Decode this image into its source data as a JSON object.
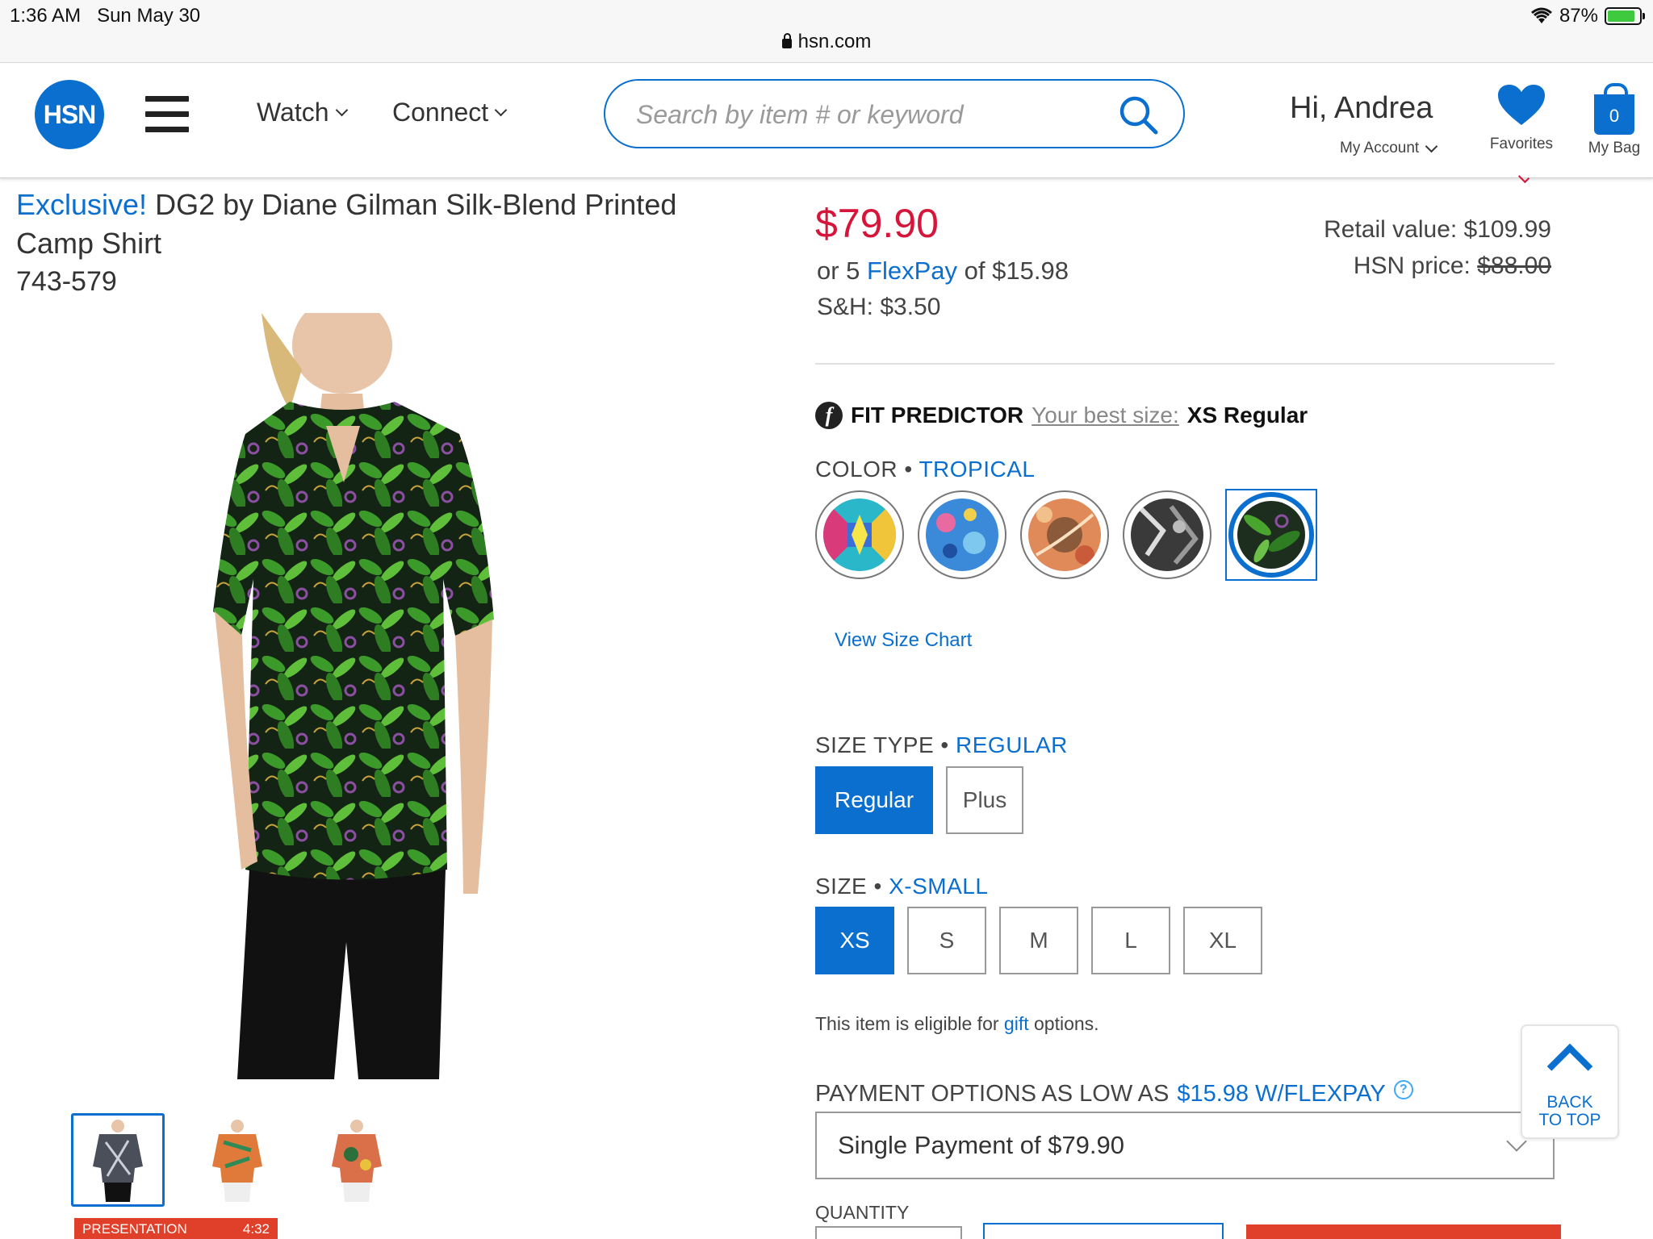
{
  "status_bar": {
    "time": "1:36 AM",
    "date": "Sun May 30",
    "battery": "87%",
    "url": "hsn.com"
  },
  "header": {
    "logo": "HSN",
    "nav": [
      {
        "label": "Watch"
      },
      {
        "label": "Connect"
      }
    ],
    "search_placeholder": "Search by item # or keyword",
    "greeting": "Hi, Andrea",
    "my_account": "My Account",
    "favorites": "Favorites",
    "bag_label": "My Bag",
    "bag_count": "0"
  },
  "product": {
    "exclusive": "Exclusive!",
    "title": "DG2 by Diane Gilman Silk-Blend Printed Camp Shirt",
    "sku": "743-579",
    "price": "$79.90",
    "flexpay_prefix": "or 5",
    "flexpay_link": "FlexPay",
    "flexpay_suffix": "of $15.98",
    "shipping": "S&H: $3.50",
    "retail_value": "Retail value: $109.99",
    "hsn_price_label": "HSN price:",
    "hsn_price_value": "$88.00"
  },
  "fit_predictor": {
    "brand": "FIT PREDICTOR",
    "best_label": "Your best size:",
    "best_size": "XS Regular"
  },
  "color": {
    "label": "COLOR",
    "selected": "TROPICAL",
    "swatches": [
      "multi-geometric",
      "blue-floral",
      "orange-paisley",
      "black-white",
      "tropical"
    ]
  },
  "size_chart": "View Size Chart",
  "size_type": {
    "label": "SIZE TYPE",
    "selected": "REGULAR",
    "options": [
      "Regular",
      "Plus"
    ]
  },
  "size": {
    "label": "SIZE",
    "selected": "X-SMALL",
    "options": [
      "XS",
      "S",
      "M",
      "L",
      "XL"
    ]
  },
  "gift": {
    "prefix": "This item is eligible for",
    "link": "gift",
    "suffix": "options."
  },
  "payment": {
    "label_prefix": "PAYMENT OPTIONS AS LOW AS",
    "label_value": "$15.98 W/FLEXPAY",
    "help": "?",
    "selected": "Single Payment of $79.90"
  },
  "quantity_label": "QUANTITY",
  "back_to_top": {
    "line1": "BACK",
    "line2": "TO TOP"
  },
  "live_badge": {
    "label": "PRESENTATION",
    "time": "4:32"
  },
  "colors": {
    "brand_blue": "#0a6fcf",
    "price_red": "#d6153a"
  }
}
